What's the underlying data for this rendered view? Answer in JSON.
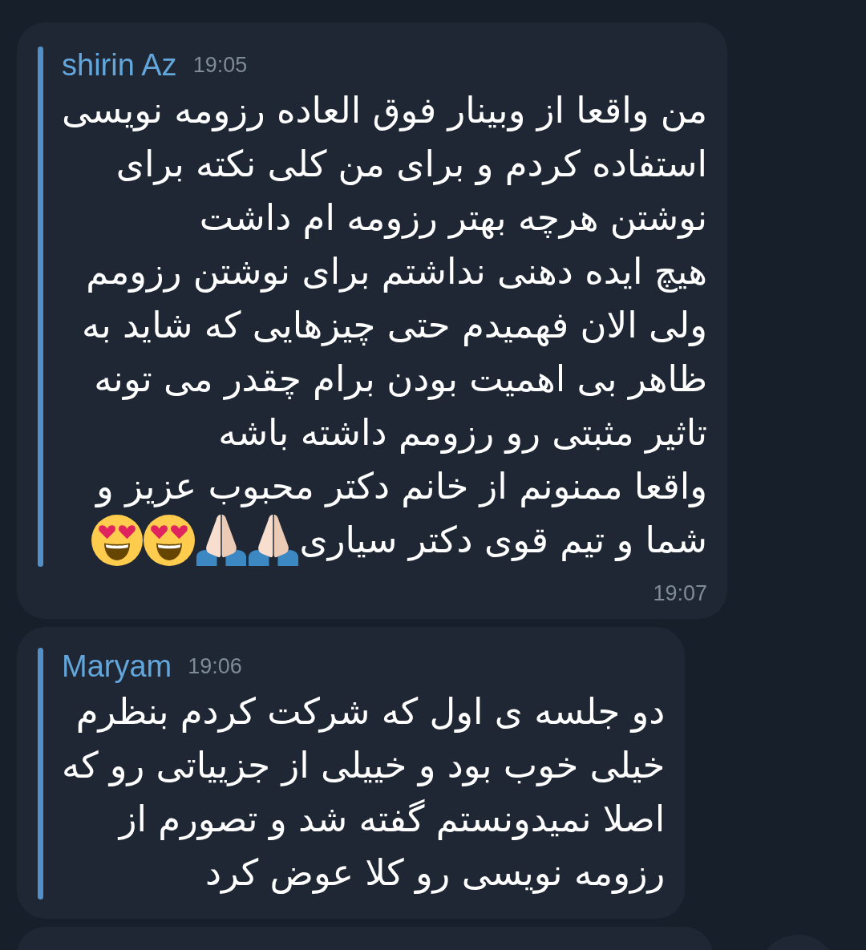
{
  "messages": [
    {
      "sender": "shirin Az",
      "sent_time": "19:05",
      "lines": [
        "من واقعا از وبینار فوق العاده رزومه نویسی",
        "استفاده کردم و برای من کلی نکته برای",
        "نوشتن هرچه بهتر رزومه ام داشت",
        "هیچ ایده دهنی نداشتم برای نوشتن رزومم",
        "ولی الان فهمیدم حتی چیزهایی که شاید به",
        "ظاهر بی اهمیت بودن برام چقدر می تونه",
        "تاثیر مثبتی رو رزومم داشته باشه",
        "واقعا ممنونم از خانم دکتر محبوب عزیز و",
        "شما و تیم قوی دکتر سیاری"
      ],
      "emojis": [
        {
          "kind": "pray"
        },
        {
          "kind": "pray"
        },
        {
          "kind": "heart-eyes"
        },
        {
          "kind": "heart-eyes"
        }
      ],
      "footer_time": "19:07"
    },
    {
      "sender": "Maryam",
      "sent_time": "19:06",
      "lines": [
        "دو جلسه ی اول که شرکت کردم بنظرم",
        "خیلی خوب بود و خییلی از جزییاتی رو که",
        "اصلا نمیدونستم گفته شد و تصورم از",
        "رزومه نویسی رو کلا عوض کرد"
      ]
    }
  ]
}
